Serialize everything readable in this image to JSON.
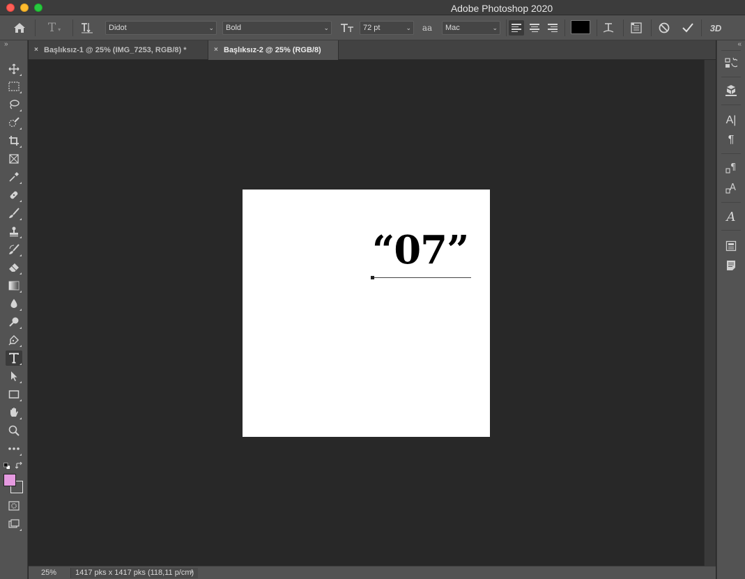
{
  "window": {
    "title": "Adobe Photoshop 2020"
  },
  "options_bar": {
    "font_family": "Didot",
    "font_style": "Bold",
    "font_size": "72 pt",
    "antialias_icon_label": "aa",
    "antialias": "Mac",
    "text_color": "#000000",
    "three_d_label": "3D"
  },
  "tabs": [
    {
      "label": "Başlıksız-1 @ 25% (IMG_7253, RGB/8) *",
      "active": false
    },
    {
      "label": "Başlıksız-2 @ 25% (RGB/8)",
      "active": true
    }
  ],
  "document": {
    "text": "“07”"
  },
  "colors": {
    "foreground": "#e59ae0",
    "background": "#535353"
  },
  "status": {
    "zoom": "25%",
    "doc_info": "1417 pks x 1417 pks (118,11 p/cm)",
    "arrow": "›"
  },
  "glyphs": {
    "tab_close": "×",
    "collapse_left": "»",
    "collapse_right": "«",
    "chevron": "⌄"
  }
}
